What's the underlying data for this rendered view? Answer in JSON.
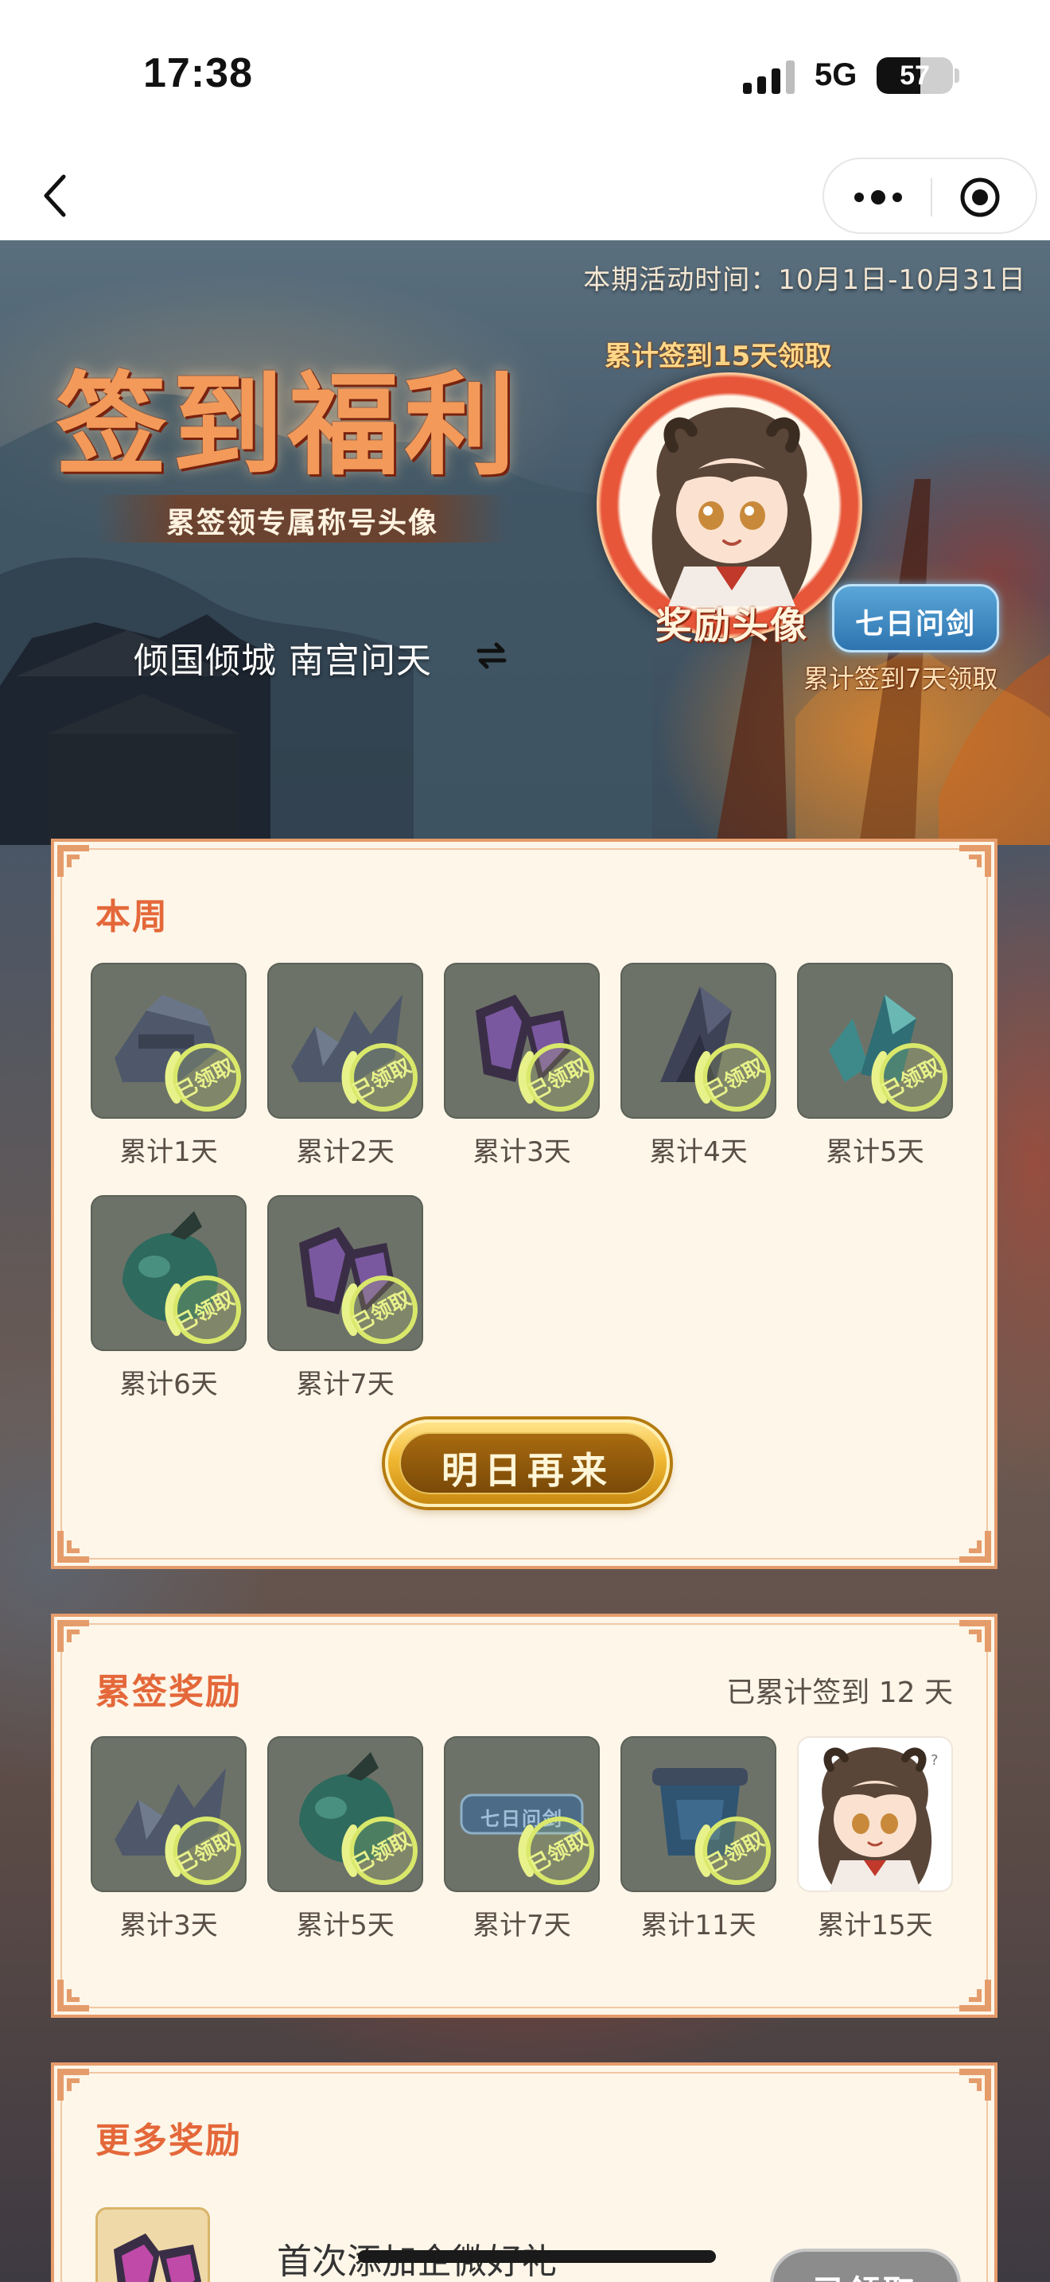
{
  "status_bar": {
    "time": "17:38",
    "network": "5G",
    "battery": "57",
    "battery_level": 0.57
  },
  "nav": {
    "back_icon": "chevron-left-icon",
    "more_icon": "more-dots-icon",
    "close_icon": "target-close-icon"
  },
  "banner": {
    "period": "本期活动时间：10月1日-10月31日",
    "title": "签到福利",
    "subtitle": "累签领专属称号头像",
    "hint_15": "累计签到15天领取",
    "avatar_label": "奖励头像",
    "title_badge": "七日问剑",
    "hint_7": "累计签到7天领取",
    "user": "倾国倾城 南宫问天",
    "switch_icon": "swap-arrows-icon"
  },
  "weekly": {
    "title": "本周",
    "claimed_text": "已领取",
    "items": [
      {
        "label": "累计1天",
        "icon": "stone-tablet-icon",
        "claimed": true
      },
      {
        "label": "累计2天",
        "icon": "broken-sword-icon",
        "claimed": true
      },
      {
        "label": "累计3天",
        "icon": "purple-gem-icon",
        "claimed": true
      },
      {
        "label": "累计4天",
        "icon": "dark-crystal-icon",
        "claimed": true
      },
      {
        "label": "累计5天",
        "icon": "teal-crystal-icon",
        "claimed": true
      },
      {
        "label": "累计6天",
        "icon": "green-pouch-icon",
        "claimed": true
      },
      {
        "label": "累计7天",
        "icon": "purple-gem-icon",
        "claimed": true
      }
    ],
    "cta": "明日再来"
  },
  "cumulative": {
    "title": "累签奖励",
    "progress_text": "已累计签到 12 天",
    "items": [
      {
        "label": "累计3天",
        "icon": "broken-sword-icon",
        "claimed": true
      },
      {
        "label": "累计5天",
        "icon": "green-pouch-icon",
        "claimed": true
      },
      {
        "label": "累计7天",
        "icon": "title-plaque-icon",
        "claimed": true,
        "plaque": "七日问剑"
      },
      {
        "label": "累计11天",
        "icon": "scroll-banner-icon",
        "claimed": true
      },
      {
        "label": "累计15天",
        "icon": "avatar-portrait-icon",
        "claimed": false
      }
    ]
  },
  "more": {
    "title": "更多奖励",
    "item_name": "首次添加企微好礼",
    "item_button": "已领取",
    "item_icon": "purple-gem-icon"
  },
  "colors": {
    "accent": "#e4683a",
    "card_bg": "#fdf6e9",
    "card_border": "#e59c6b",
    "tile_bg": "#6d7268",
    "claimed_seal": "#d9e86a",
    "cta_gold": "#f0b832"
  }
}
